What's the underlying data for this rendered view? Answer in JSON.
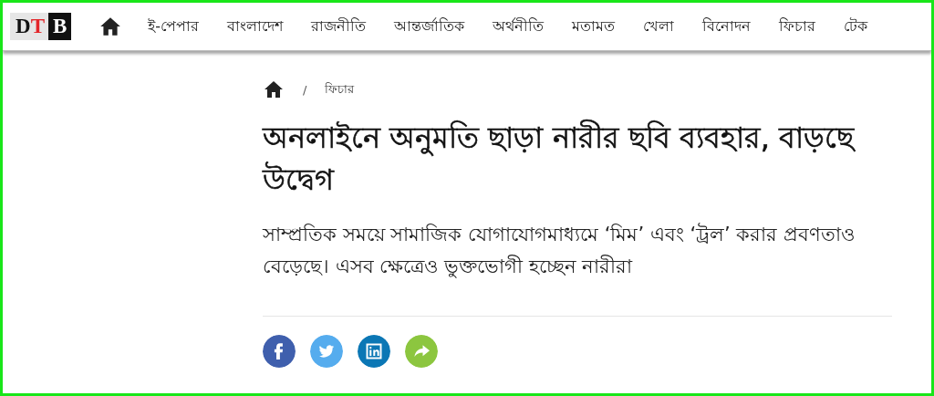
{
  "logo": {
    "parts": [
      {
        "text": "D",
        "color": "#111111"
      },
      {
        "text": "T",
        "color": "#e3262a"
      }
    ],
    "badge": "B"
  },
  "nav": {
    "items": [
      {
        "label": "ই-পেপার"
      },
      {
        "label": "বাংলাদেশ"
      },
      {
        "label": "রাজনীতি"
      },
      {
        "label": "আন্তর্জাতিক"
      },
      {
        "label": "অর্থনীতি"
      },
      {
        "label": "মতামত"
      },
      {
        "label": "খেলা"
      },
      {
        "label": "বিনোদন"
      },
      {
        "label": "ফিচার"
      },
      {
        "label": "টেক"
      }
    ]
  },
  "breadcrumb": {
    "separator": "/",
    "section": "ফিচার"
  },
  "article": {
    "headline": "অনলাইনে অনুমতি ছাড়া নারীর ছবি ব্যবহার, বাড়ছে উদ্বেগ",
    "summary": "সাম্প্রতিক সময়ে সামাজিক যোগাযোগমাধ্যমে ‘মিম’ এবং ‘ট্রল’ করার প্রবণতাও বেড়েছে। এসব ক্ষেত্রেও ভুক্তভোগী হচ্ছেন নারীরা"
  },
  "share": [
    {
      "kind": "facebook",
      "color": "#3f5fad"
    },
    {
      "kind": "twitter",
      "color": "#55acee"
    },
    {
      "kind": "linkedin",
      "color": "#0b77b5"
    },
    {
      "kind": "share",
      "color": "#8cc63f"
    }
  ]
}
